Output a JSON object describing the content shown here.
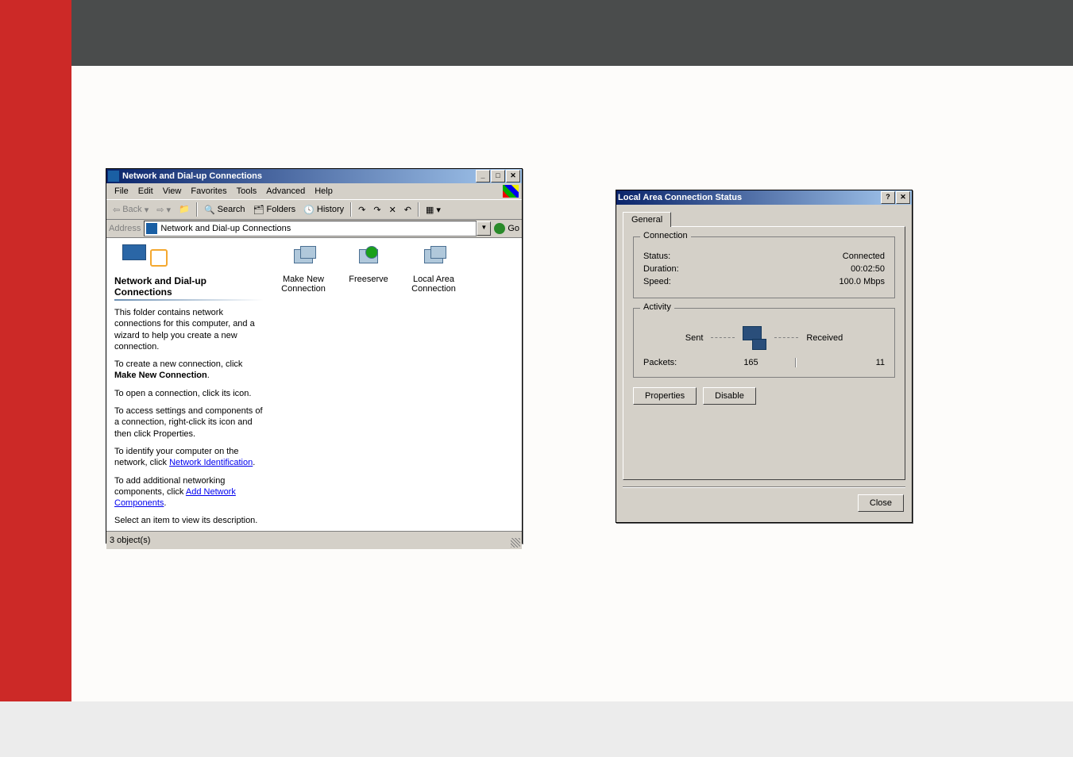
{
  "window1": {
    "title": "Network and Dial-up Connections",
    "menu": [
      "File",
      "Edit",
      "View",
      "Favorites",
      "Tools",
      "Advanced",
      "Help"
    ],
    "toolbar": {
      "back": "Back",
      "search": "Search",
      "folders": "Folders",
      "history": "History"
    },
    "address": {
      "label": "Address",
      "value": "Network and Dial-up Connections",
      "go": "Go"
    },
    "sidebar": {
      "title": "Network and Dial-up Connections",
      "p1": "This folder contains network connections for this computer, and a wizard to help you create a new connection.",
      "p2a": "To create a new connection, click ",
      "p2b": "Make New Connection",
      "p3": "To open a connection, click its icon.",
      "p4": "To access settings and components of a connection, right-click its icon and then click Properties.",
      "p5a": "To identify your computer on the network, click ",
      "p5link": "Network Identification",
      "p6a": "To add additional networking components, click ",
      "p6link": "Add Network Components",
      "p7": "Select an item to view its description."
    },
    "icons": {
      "makeNew": "Make New Connection",
      "freeserve": "Freeserve",
      "lan": "Local Area Connection"
    },
    "status": "3 object(s)"
  },
  "window2": {
    "title": "Local Area Connection Status",
    "tab": "General",
    "connGroup": "Connection",
    "statusLabel": "Status:",
    "statusValue": "Connected",
    "durationLabel": "Duration:",
    "durationValue": "00:02:50",
    "speedLabel": "Speed:",
    "speedValue": "100.0 Mbps",
    "activityGroup": "Activity",
    "sent": "Sent",
    "received": "Received",
    "packetsLabel": "Packets:",
    "packetsSent": "165",
    "packetsRecv": "11",
    "props": "Properties",
    "disable": "Disable",
    "close": "Close"
  }
}
